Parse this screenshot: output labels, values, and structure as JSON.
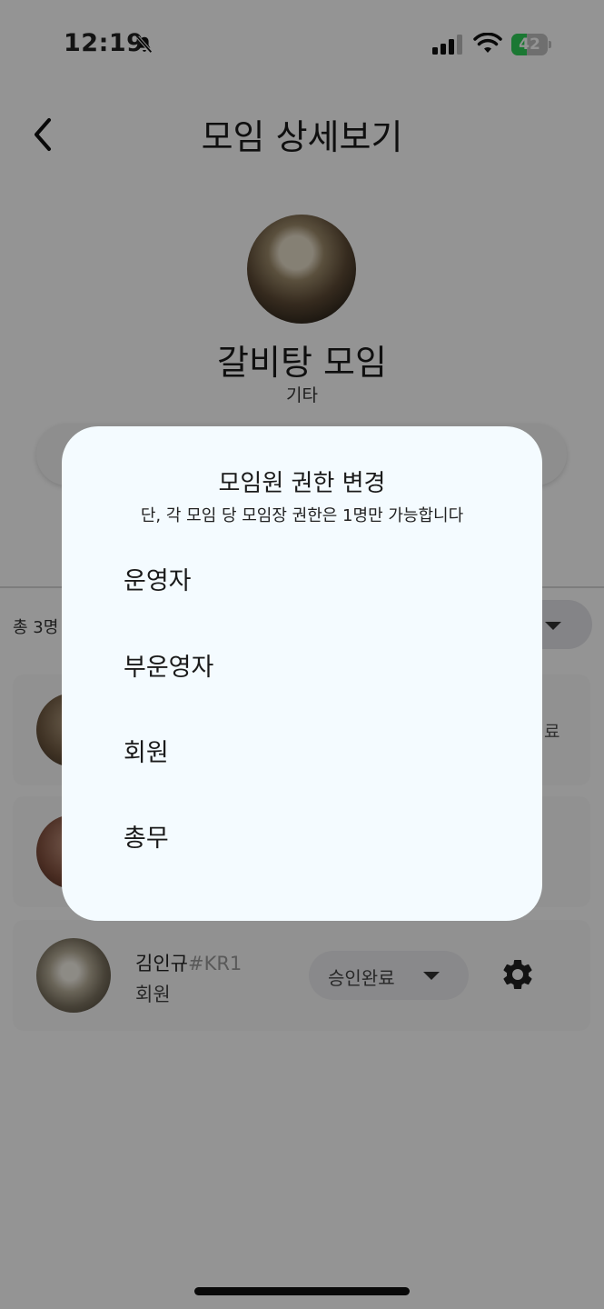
{
  "status_bar": {
    "time": "12:19",
    "battery_percent": 42,
    "battery_label": "42"
  },
  "header": {
    "title": "모임 상세보기"
  },
  "group": {
    "name": "갈비탕 모임",
    "category": "기타"
  },
  "members": {
    "count_label": "총 3명",
    "list": [
      {
        "status_edge": "료"
      },
      {},
      {
        "name": "김인규",
        "tag": "#KR1",
        "role": "회원",
        "status": "승인완료"
      }
    ]
  },
  "modal": {
    "title": "모임원 권한 변경",
    "subtitle": "단, 각 모임 당 모임장 권한은 1명만 가능합니다",
    "options": [
      "운영자",
      "부운영자",
      "회원",
      "총무"
    ]
  }
}
